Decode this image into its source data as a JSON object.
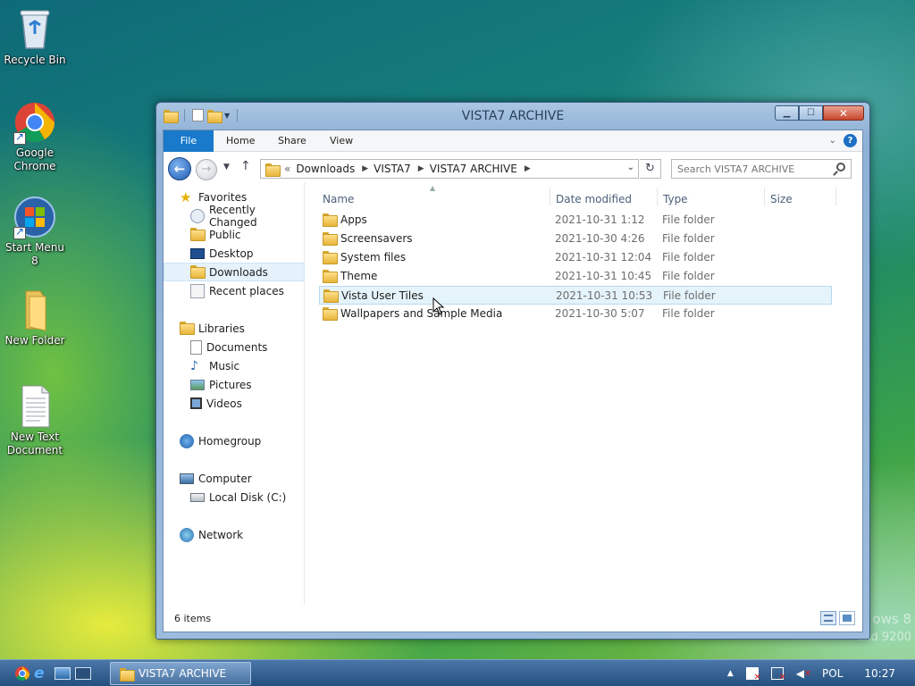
{
  "desktop": {
    "icons": [
      {
        "label": "Recycle Bin"
      },
      {
        "label": "Google Chrome"
      },
      {
        "label": "Start Menu 8"
      },
      {
        "label": "New Folder"
      },
      {
        "label": "New Text Document"
      }
    ],
    "watermark_line1": "ows 8",
    "watermark_line2": "uild 9200"
  },
  "window": {
    "title": "VISTA7 ARCHIVE",
    "ribbon_tabs": [
      "File",
      "Home",
      "Share",
      "View"
    ],
    "address": {
      "overflow": "«",
      "crumbs": [
        "Downloads",
        "VISTA7",
        "VISTA7 ARCHIVE"
      ]
    },
    "search_placeholder": "Search VISTA7 ARCHIVE",
    "nav_pane": {
      "favorites": {
        "label": "Favorites",
        "items": [
          "Recently Changed",
          "Public",
          "Desktop",
          "Downloads",
          "Recent places"
        ]
      },
      "libraries": {
        "label": "Libraries",
        "items": [
          "Documents",
          "Music",
          "Pictures",
          "Videos"
        ]
      },
      "homegroup": "Homegroup",
      "computer": {
        "label": "Computer",
        "items": [
          "Local Disk (C:)"
        ]
      },
      "network": "Network",
      "selected": "Downloads"
    },
    "columns": [
      "Name",
      "Date modified",
      "Type",
      "Size"
    ],
    "rows": [
      {
        "name": "Apps",
        "date": "2021-10-31 1:12",
        "type": "File folder"
      },
      {
        "name": "Screensavers",
        "date": "2021-10-30 4:26",
        "type": "File folder"
      },
      {
        "name": "System files",
        "date": "2021-10-31 12:04",
        "type": "File folder"
      },
      {
        "name": "Theme",
        "date": "2021-10-31 10:45",
        "type": "File folder"
      },
      {
        "name": "Vista User Tiles",
        "date": "2021-10-31 10:53",
        "type": "File folder"
      },
      {
        "name": "Wallpapers and Sample Media",
        "date": "2021-10-30 5:07",
        "type": "File folder"
      }
    ],
    "hovered_row": "Vista User Tiles",
    "status": "6 items"
  },
  "taskbar": {
    "app_label": "VISTA7 ARCHIVE",
    "language": "POL",
    "time": "10:27"
  }
}
